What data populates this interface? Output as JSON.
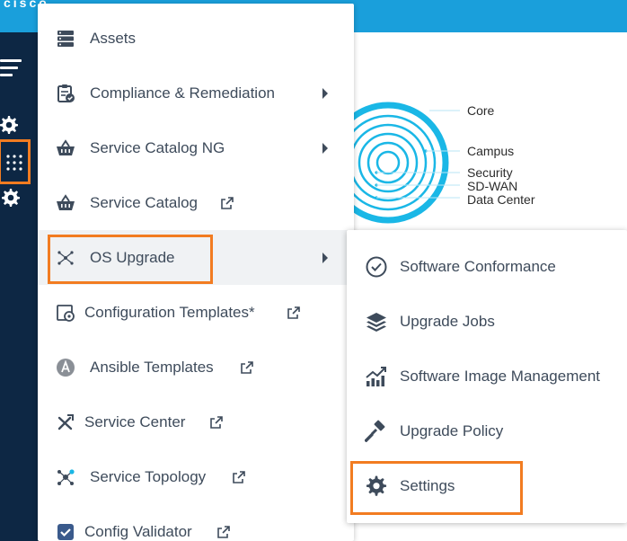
{
  "header": {
    "brand": "cisco"
  },
  "radar": {
    "levels": [
      "Core",
      "Campus",
      "Security",
      "SD-WAN",
      "Data Center"
    ],
    "color": "#1ab7e6"
  },
  "menu": {
    "items": [
      {
        "label": "Assets",
        "icon": "assets-icon"
      },
      {
        "label": "Compliance & Remediation",
        "icon": "compliance-icon"
      },
      {
        "label": "Service Catalog NG",
        "icon": "basket-icon"
      },
      {
        "label": "Service Catalog",
        "icon": "basket-icon"
      },
      {
        "label": "OS Upgrade",
        "icon": "os-upgrade-icon"
      },
      {
        "label": "Configuration Templates*",
        "icon": "config-template-icon"
      },
      {
        "label": "Ansible Templates",
        "icon": "ansible-icon"
      },
      {
        "label": "Service Center",
        "icon": "tools-icon"
      },
      {
        "label": "Service Topology",
        "icon": "topology-icon"
      },
      {
        "label": "Config Validator",
        "icon": "checkbox-icon"
      }
    ]
  },
  "submenu": {
    "items": [
      {
        "label": "Software Conformance",
        "icon": "check-circle-icon"
      },
      {
        "label": "Upgrade Jobs",
        "icon": "layers-icon"
      },
      {
        "label": "Software Image Management",
        "icon": "chart-trend-icon"
      },
      {
        "label": "Upgrade Policy",
        "icon": "gavel-icon"
      },
      {
        "label": "Settings",
        "icon": "gear-icon"
      }
    ]
  },
  "colors": {
    "accent": "#1a9fdb",
    "nav": "#0d2744",
    "highlight": "#f27c21",
    "text": "#3e4b5b"
  }
}
